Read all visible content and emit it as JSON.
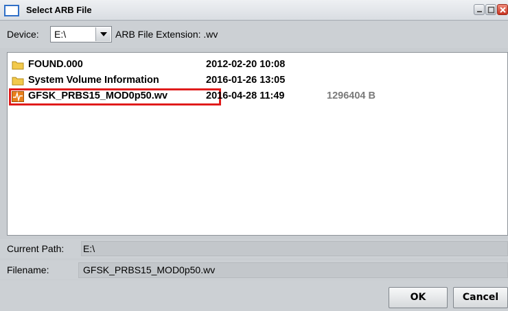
{
  "window": {
    "title": "Select ARB File"
  },
  "device": {
    "label": "Device:",
    "value": "E:\\",
    "extension_label": "ARB File Extension: .wv"
  },
  "files": [
    {
      "name": "FOUND.000",
      "date": "2012-02-20 10:08",
      "size": "",
      "icon": "folder-icon"
    },
    {
      "name": "System Volume Information",
      "date": "2016-01-26 13:05",
      "size": "",
      "icon": "folder-icon"
    },
    {
      "name": "GFSK_PRBS15_MOD0p50.wv",
      "date": "2016-04-28 11:49",
      "size": "1296404 B",
      "icon": "waveform-file-icon",
      "selected": true
    }
  ],
  "path": {
    "label": "Current Path:",
    "value": "E:\\"
  },
  "filename": {
    "label": "Filename:",
    "value": "GFSK_PRBS15_MOD0p50.wv"
  },
  "buttons": {
    "ok_label": "OK",
    "cancel_label": "Cancel"
  },
  "colors": {
    "selection_outline": "#e01b1b",
    "folder": "#f2c94c",
    "waveform_icon": "#e87f1b"
  }
}
